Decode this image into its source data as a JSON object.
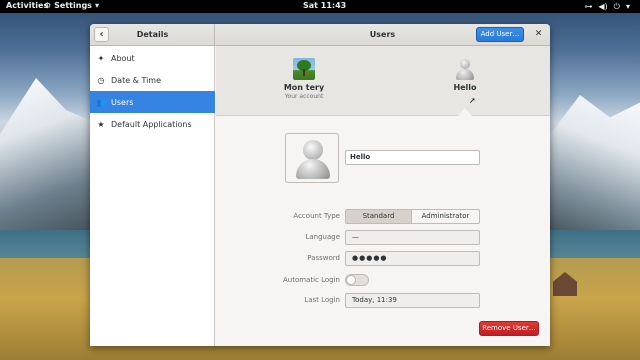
{
  "topbar": {
    "activities": "Activities",
    "app_menu": "Settings",
    "clock": "Sat 11:43"
  },
  "window": {
    "sidebar_title": "Details",
    "title": "Users",
    "add_user_label": "Add User…",
    "close_icon": "close-icon"
  },
  "sidebar": {
    "items": [
      {
        "label": "About",
        "icon": "sparkle-icon"
      },
      {
        "label": "Date & Time",
        "icon": "clock-icon"
      },
      {
        "label": "Users",
        "icon": "users-icon",
        "active": true
      },
      {
        "label": "Default Applications",
        "icon": "star-icon"
      }
    ]
  },
  "users": [
    {
      "name": "Mon tery",
      "subtitle": "Your account",
      "avatar": "tree"
    },
    {
      "name": "Hello",
      "subtitle": "",
      "avatar": "generic",
      "selected": true
    }
  ],
  "form": {
    "name_value": "Hello",
    "account_type_label": "Account Type",
    "account_type_options": [
      "Standard",
      "Administrator"
    ],
    "account_type_selected": "Standard",
    "language_label": "Language",
    "language_value": "—",
    "password_label": "Password",
    "password_value": "●●●●●",
    "automatic_login_label": "Automatic Login",
    "automatic_login": false,
    "last_login_label": "Last Login",
    "last_login_value": "Today, 11:39"
  },
  "remove_user_label": "Remove User…",
  "colors": {
    "accent": "#3584e4",
    "destructive": "#c01c28"
  }
}
